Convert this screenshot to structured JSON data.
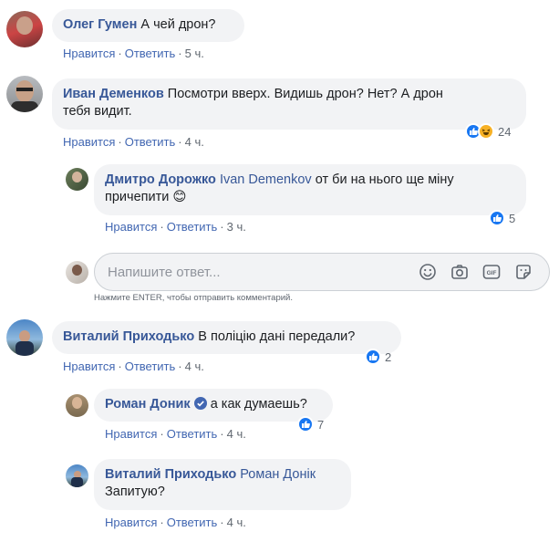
{
  "comments": [
    {
      "author": "Олег Гумен",
      "text": "А чей дрон?",
      "like": "Нравится",
      "reply": "Ответить",
      "time": "5 ч."
    },
    {
      "author": "Иван Деменков",
      "text_line1": "Посмотри вверх. Видишь дрон? Нет? А дрон",
      "text_line2": "тебя видит.",
      "like": "Нравится",
      "reply": "Ответить",
      "time": "4 ч.",
      "reactions": "24"
    },
    {
      "author": "Дмитро Дорожко",
      "mention": "Ivan Demenkov",
      "text_line1": "от би на нього ще міну",
      "text_line2": "причепити",
      "emoji": "😊",
      "like": "Нравится",
      "reply": "Ответить",
      "time": "3 ч.",
      "reactions": "5"
    },
    {
      "author": "Виталий Приходько",
      "text": "В поліцію дані передали?",
      "like": "Нравится",
      "reply": "Ответить",
      "time": "4 ч.",
      "reactions": "2"
    },
    {
      "author": "Роман Доник",
      "text": "а как думаешь?",
      "like": "Нравится",
      "reply": "Ответить",
      "time": "4 ч.",
      "reactions": "7"
    },
    {
      "author": "Виталий Приходько",
      "mention": "Роман Донік",
      "text_line2": "Запитую?",
      "like": "Нравится",
      "reply": "Ответить",
      "time": "4 ч."
    }
  ],
  "reply_box": {
    "placeholder": "Напишите ответ...",
    "hint": "Нажмите ENTER, чтобы отправить комментарий."
  },
  "colors": {
    "link": "#385898",
    "bubble": "#f2f3f5",
    "like_blue": "#1877f2"
  },
  "icons": [
    "emoji-icon",
    "camera-icon",
    "gif-icon",
    "sticker-icon",
    "like-reaction-icon",
    "haha-reaction-icon",
    "verified-badge-icon"
  ]
}
